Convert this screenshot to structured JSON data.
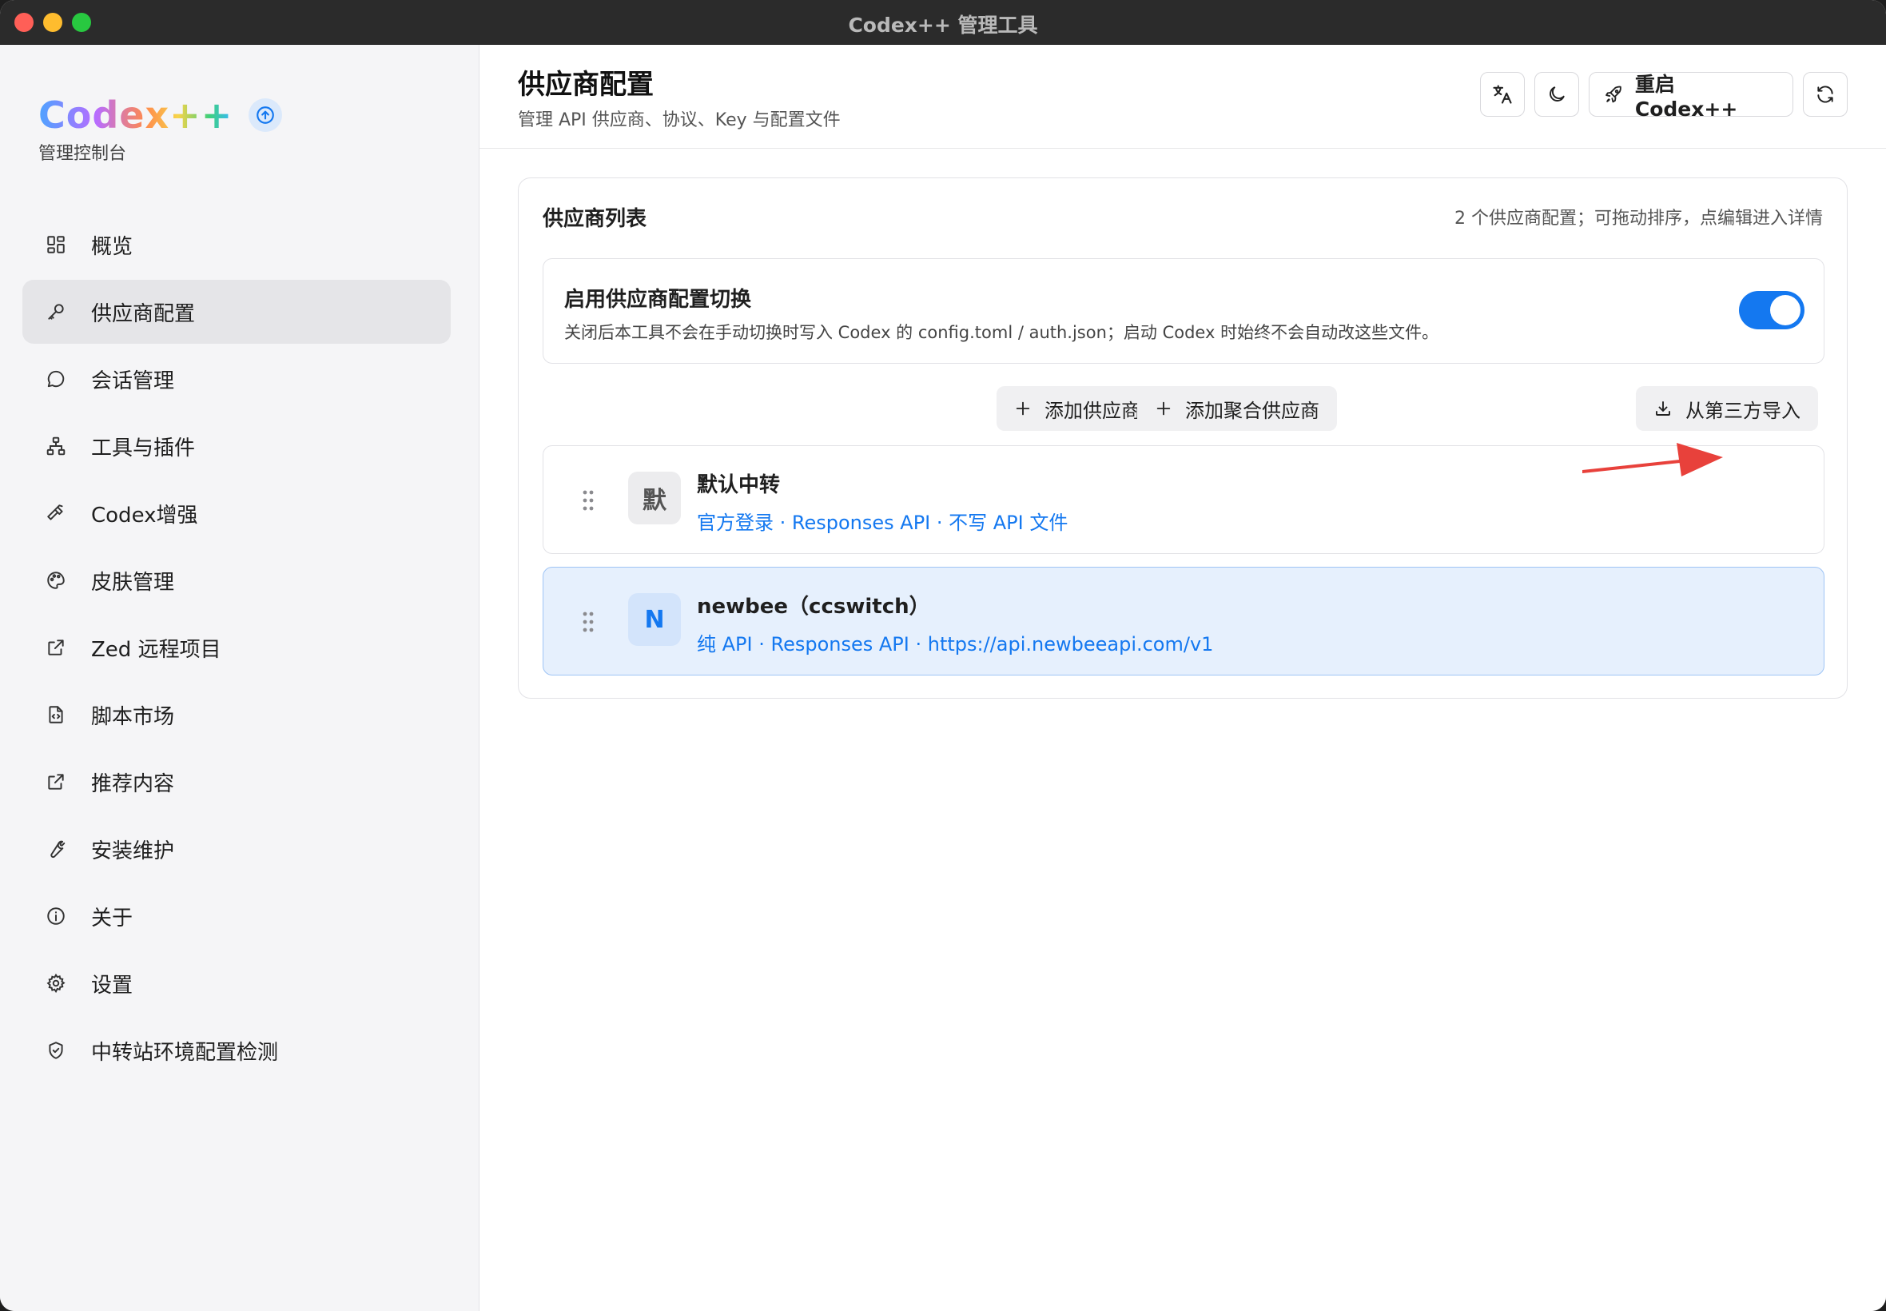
{
  "window": {
    "title": "Codex++ 管理工具"
  },
  "sidebar": {
    "brand": "Codex++",
    "subtitle": "管理控制台",
    "items": [
      {
        "label": "概览",
        "icon": "grid-icon"
      },
      {
        "label": "供应商配置",
        "icon": "key-icon",
        "active": true
      },
      {
        "label": "会话管理",
        "icon": "chat-bubble-icon"
      },
      {
        "label": "工具与插件",
        "icon": "network-icon"
      },
      {
        "label": "Codex增强",
        "icon": "hammer-icon"
      },
      {
        "label": "皮肤管理",
        "icon": "palette-icon"
      },
      {
        "label": "Zed 远程项目",
        "icon": "external-link-icon"
      },
      {
        "label": "脚本市场",
        "icon": "file-code-icon"
      },
      {
        "label": "推荐内容",
        "icon": "external-link-icon"
      },
      {
        "label": "安装维护",
        "icon": "wrench-icon"
      },
      {
        "label": "关于",
        "icon": "info-icon"
      },
      {
        "label": "设置",
        "icon": "gear-icon"
      },
      {
        "label": "中转站环境配置检测",
        "icon": "shield-check-icon"
      }
    ]
  },
  "header": {
    "title": "供应商配置",
    "subtitle": "管理 API 供应商、协议、Key 与配置文件",
    "restart_label": "重启 Codex++"
  },
  "providers_card": {
    "title": "供应商列表",
    "meta": "2 个供应商配置；可拖动排序，点编辑进入详情",
    "toggle": {
      "title": "启用供应商配置切换",
      "description": "关闭后本工具不会在手动切换时写入 Codex 的 config.toml / auth.json；启动 Codex 时始终不会自动改这些文件。",
      "enabled": true
    },
    "actions": {
      "add": "添加供应商",
      "add_aggregate": "添加聚合供应商",
      "import": "从第三方导入"
    },
    "providers": [
      {
        "avatar": "默",
        "name": "默认中转",
        "meta": "官方登录 · Responses API · 不写 API 文件",
        "selected": false
      },
      {
        "avatar": "N",
        "name": "newbee（ccswitch）",
        "meta": "纯 API · Responses API · https://api.newbeeapi.com/v1",
        "selected": true
      }
    ]
  },
  "colors": {
    "accent": "#1478f0",
    "annotation_arrow": "#e8413b"
  }
}
